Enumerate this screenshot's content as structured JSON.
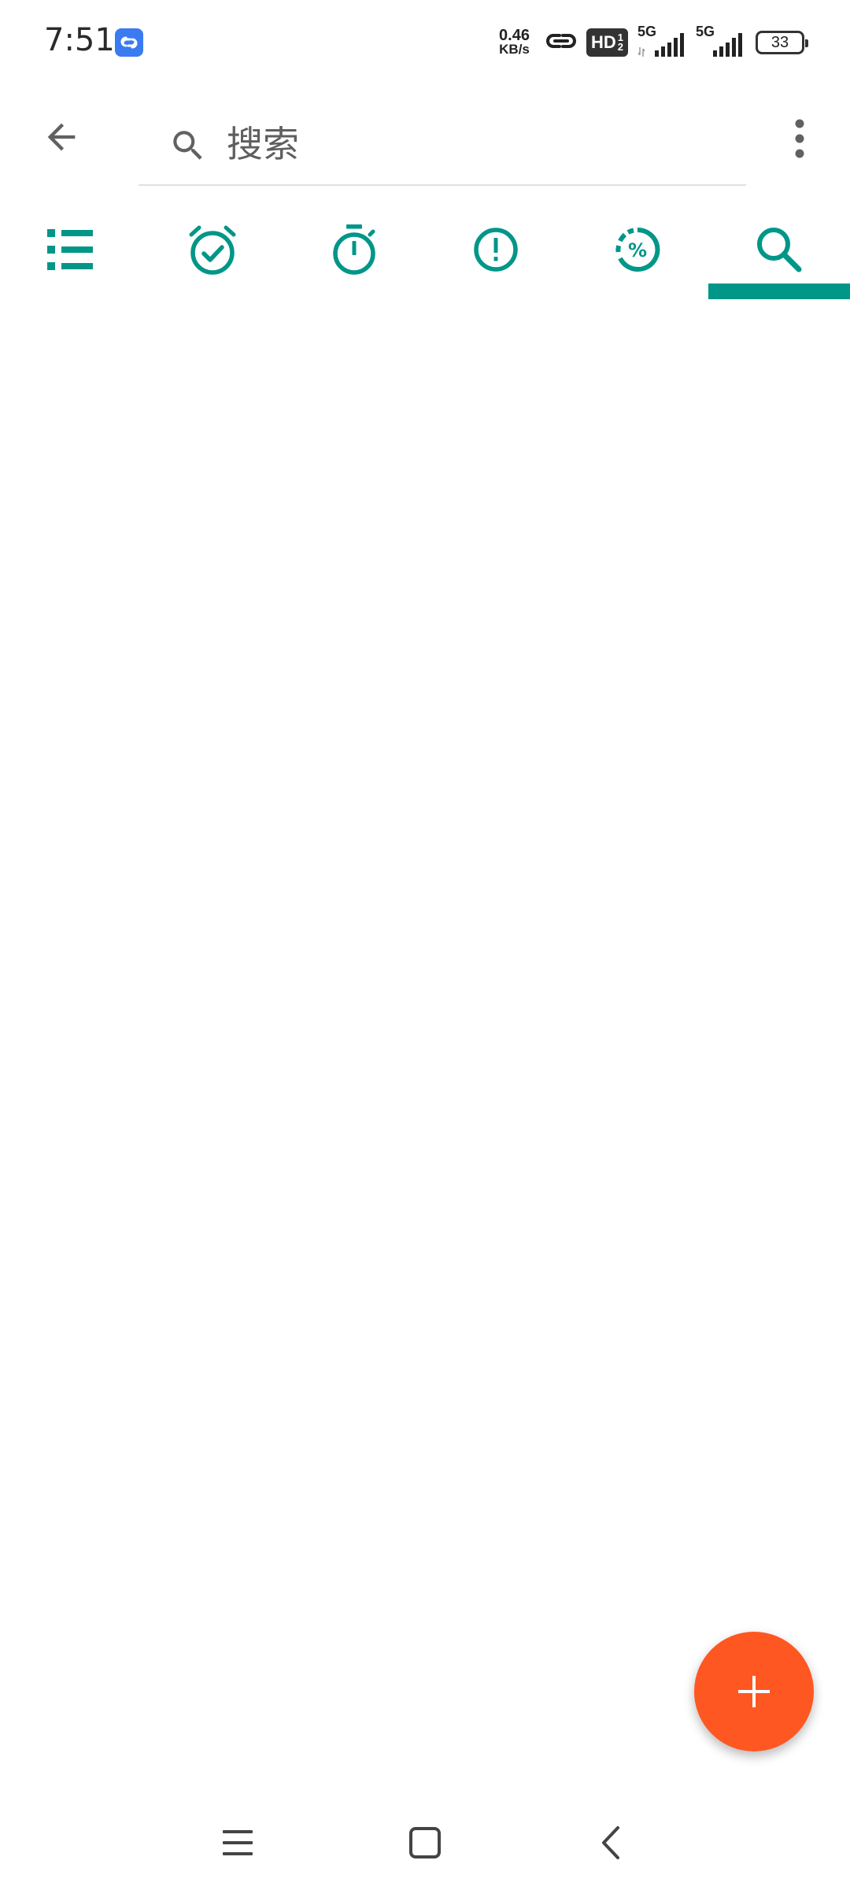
{
  "status_bar": {
    "time": "7:51",
    "net_speed_value": "0.46",
    "net_speed_unit": "KB/s",
    "hd_label": "HD",
    "hd_sub_top": "1",
    "hd_sub_bottom": "2",
    "sim1_label": "5G",
    "sim2_label": "5G",
    "battery_level": "33",
    "app_icon": "link-app-icon",
    "hotspot_icon": "link-icon"
  },
  "app_bar": {
    "back_icon": "arrow-back-icon",
    "search": {
      "placeholder": "搜索",
      "value": "",
      "icon": "search-icon"
    },
    "more_icon": "more-vert-icon"
  },
  "tabs": [
    {
      "icon": "list-icon",
      "selected": false
    },
    {
      "icon": "alarm-check-icon",
      "selected": false
    },
    {
      "icon": "timer-icon",
      "selected": false
    },
    {
      "icon": "priority-icon",
      "selected": false
    },
    {
      "icon": "progress-percent-icon",
      "selected": false
    },
    {
      "icon": "search-icon",
      "selected": true
    }
  ],
  "fab": {
    "icon": "add-icon"
  },
  "nav_bar": {
    "menu_icon": "menu-icon",
    "home_icon": "home-square-icon",
    "back_icon": "back-chevron-icon"
  },
  "colors": {
    "accent": "#009688",
    "fab": "#ff5722",
    "icon_gray": "#616161",
    "background": "#ffffff"
  }
}
